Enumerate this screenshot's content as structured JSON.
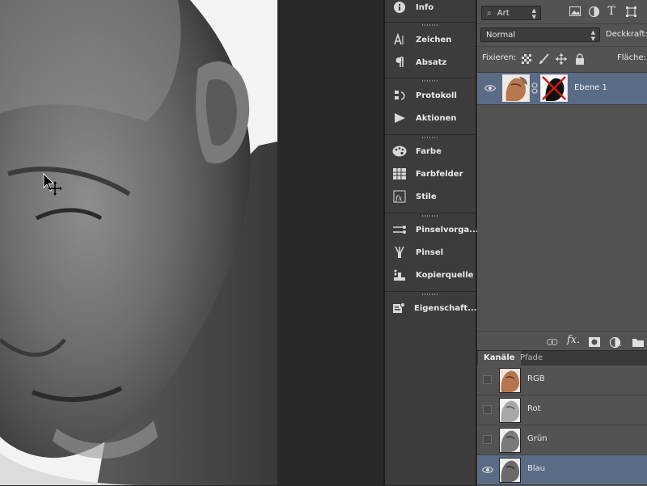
{
  "dock": {
    "items": [
      {
        "label": "Info",
        "icon": "info-icon"
      },
      {
        "label": "Zeichen",
        "icon": "character-icon"
      },
      {
        "label": "Absatz",
        "icon": "paragraph-icon"
      },
      {
        "label": "Protokoll",
        "icon": "history-icon"
      },
      {
        "label": "Aktionen",
        "icon": "actions-play-icon"
      },
      {
        "label": "Farbe",
        "icon": "palette-icon"
      },
      {
        "label": "Farbfelder",
        "icon": "swatches-icon"
      },
      {
        "label": "Stile",
        "icon": "styles-fx-icon"
      },
      {
        "label": "Pinselvorga...",
        "icon": "brush-presets-icon"
      },
      {
        "label": "Pinsel",
        "icon": "brush-icon"
      },
      {
        "label": "Kopierquelle",
        "icon": "clone-source-icon"
      },
      {
        "label": "Eigenschaft...",
        "icon": "properties-icon"
      }
    ]
  },
  "layers_panel": {
    "filter_label": "Art",
    "blend_mode": "Normal",
    "opacity_label": "Deckkraft:",
    "lock_label": "Fixieren:",
    "fill_label": "Fläche:",
    "layers": [
      {
        "name": "Ebene 1",
        "visible": true,
        "selected": true,
        "has_mask": true
      }
    ],
    "footer_icons": [
      "link-icon",
      "fx-icon",
      "mask-icon",
      "adjustment-icon",
      "folder-icon"
    ]
  },
  "channels_panel": {
    "tabs": [
      {
        "label": "Kanäle",
        "active": true
      },
      {
        "label": "Pfade",
        "active": false
      }
    ],
    "channels": [
      {
        "name": "RGB",
        "visible": false,
        "selected": false
      },
      {
        "name": "Rot",
        "visible": false,
        "selected": false
      },
      {
        "name": "Grün",
        "visible": false,
        "selected": false
      },
      {
        "name": "Blau",
        "visible": true,
        "selected": true
      }
    ]
  },
  "colors": {
    "panel_bg": "#535353",
    "dock_bg": "#3c3c3c",
    "selection": "#5a6b85",
    "workspace": "#282828"
  }
}
